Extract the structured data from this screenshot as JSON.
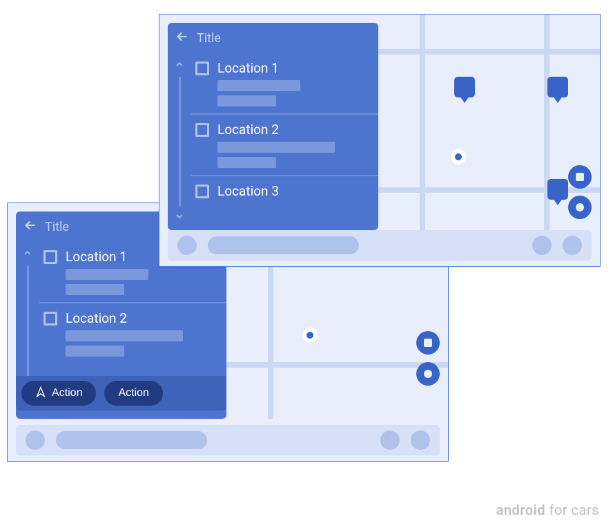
{
  "colors": {
    "panel_bg": "#4d74cf",
    "panel_dark": "#203b80",
    "accent": "#3863c8",
    "surface": "#e8eefb"
  },
  "window_front": {
    "title": "Title",
    "items": [
      {
        "label": "Location 1"
      },
      {
        "label": "Location 2"
      },
      {
        "label": "Location 3"
      }
    ]
  },
  "window_back": {
    "title": "Title",
    "items": [
      {
        "label": "Location 1"
      },
      {
        "label": "Location 2"
      }
    ],
    "actions": [
      {
        "label": "Action"
      },
      {
        "label": "Action"
      }
    ]
  },
  "watermark": {
    "brand": "android",
    "suffix": " for cars"
  }
}
